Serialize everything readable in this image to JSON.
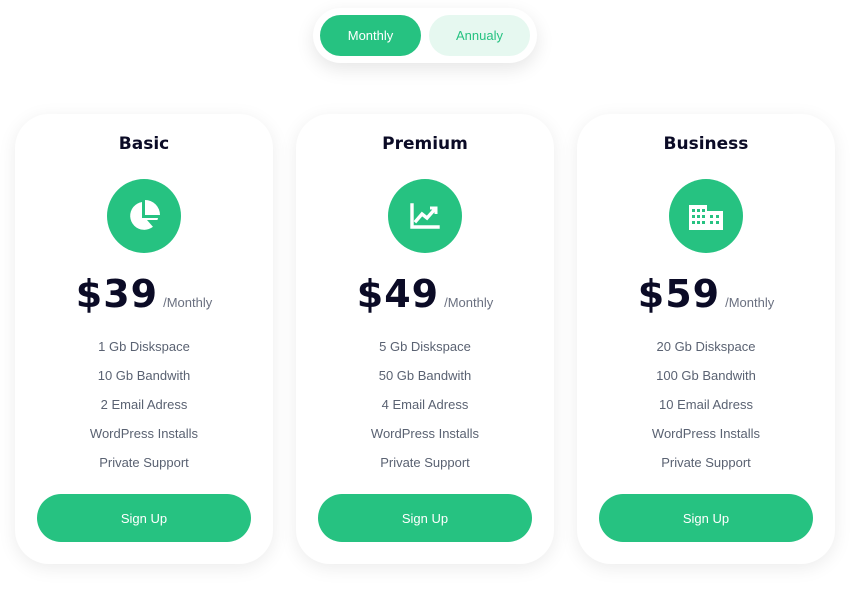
{
  "billing_toggle": {
    "monthly_label": "Monthly",
    "annual_label": "Annualy",
    "selected": "Monthly"
  },
  "colors": {
    "accent": "#26c281",
    "accent_light": "#e6f8f0",
    "heading": "#0b0b26",
    "muted": "#5a6272"
  },
  "plans": [
    {
      "name": "Basic",
      "icon": "pie-chart-icon",
      "price": "$39",
      "period": "/Monthly",
      "features": [
        "1 Gb Diskspace",
        "10 Gb Bandwith",
        "2 Email Adress",
        "WordPress Installs",
        "Private Support"
      ],
      "cta": "Sign Up"
    },
    {
      "name": "Premium",
      "icon": "line-chart-icon",
      "price": "$49",
      "period": "/Monthly",
      "features": [
        "5 Gb Diskspace",
        "50 Gb Bandwith",
        "4 Email Adress",
        "WordPress Installs",
        "Private Support"
      ],
      "cta": "Sign Up"
    },
    {
      "name": "Business",
      "icon": "building-icon",
      "price": "$59",
      "period": "/Monthly",
      "features": [
        "20 Gb Diskspace",
        "100 Gb Bandwith",
        "10 Email Adress",
        "WordPress Installs",
        "Private Support"
      ],
      "cta": "Sign Up"
    }
  ]
}
